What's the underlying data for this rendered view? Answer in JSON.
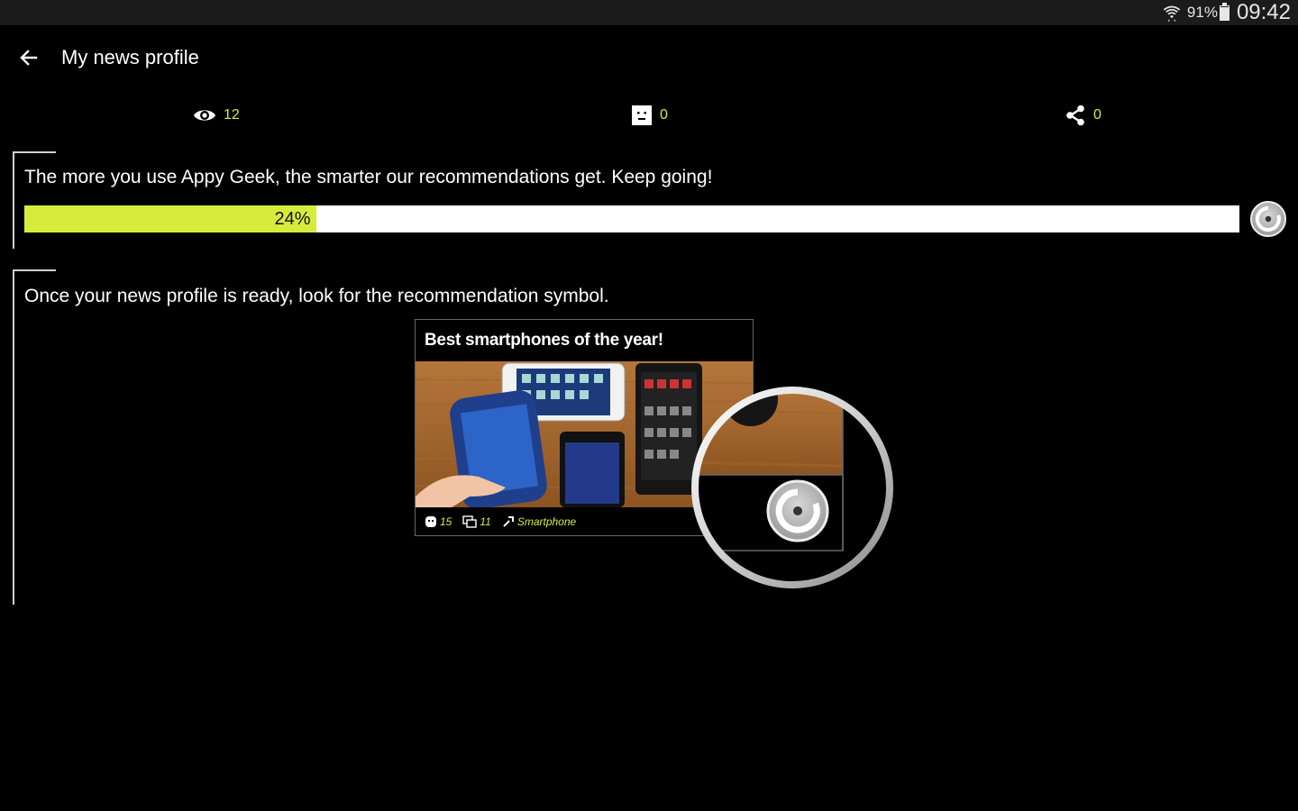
{
  "status": {
    "battery": "91%",
    "battery_level": 0.91,
    "time": "09:42",
    "wifi_icon": "wifi-icon"
  },
  "header": {
    "title": "My news profile",
    "back_icon": "arrow-left-icon"
  },
  "stats": {
    "views": {
      "icon": "eye-icon",
      "value": "12"
    },
    "comments": {
      "icon": "comment-icon",
      "value": "0"
    },
    "shares": {
      "icon": "share-icon",
      "value": "0"
    }
  },
  "progress_card": {
    "message": "The more you use Appy Geek, the smarter our recommendations get. Keep going!",
    "progress_label": "24%",
    "progress_value": 0.24,
    "badge_icon": "recommendation-icon"
  },
  "symbol_card": {
    "message": "Once your news profile is ready, look for the recommendation symbol.",
    "preview": {
      "title": "Best smartphones of the year!",
      "likes": "15",
      "comments": "11",
      "category": "Smartphone"
    }
  },
  "colors": {
    "accent": "#d6ec3c",
    "background": "#000000",
    "status_bar": "#1b1b1b"
  }
}
